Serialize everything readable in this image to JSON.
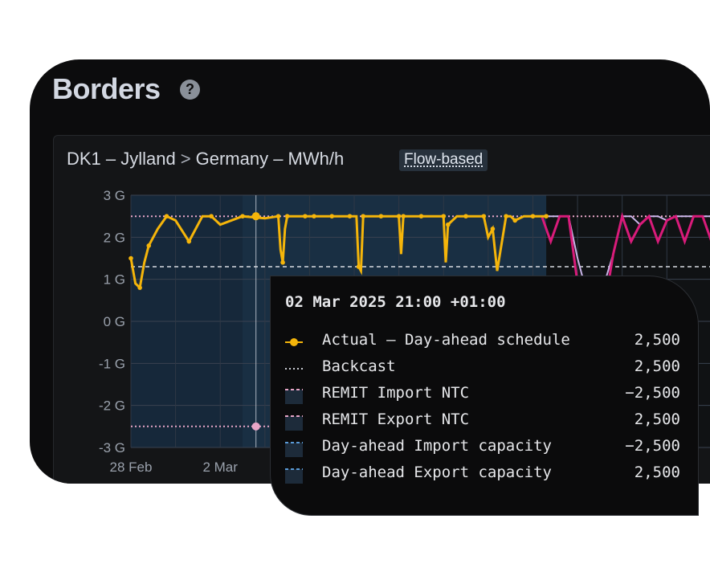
{
  "header": {
    "title": "Borders",
    "help_icon_text": "?"
  },
  "chart_header": {
    "from": "DK1 – Jylland",
    "separator": ">",
    "to": "Germany – MWh/h",
    "badge": "Flow-based"
  },
  "colors": {
    "actual": "#f5b50a",
    "backcast": "#c9b5e8",
    "remit": "#e8a6c8",
    "dayahead_capacity": "#5a9bd8",
    "magenta": "#d81b7a",
    "background": "#0c0c0d",
    "plot_fill": "#16283a"
  },
  "chart_data": {
    "type": "line",
    "ylim": [
      -3000,
      3000
    ],
    "yticks": [
      3000,
      2000,
      1000,
      0,
      -1000,
      -2000,
      -3000
    ],
    "ytick_labels": [
      "3 G",
      "2 G",
      "1 G",
      "0 G",
      "-1 G",
      "-2 G",
      "-3 G"
    ],
    "xtick_labels": [
      "28 Feb",
      "2 Mar"
    ],
    "grid": true,
    "series": [
      {
        "name": "Actual - Day-ahead schedule",
        "x": [
          0,
          0.1,
          0.2,
          0.3,
          0.4,
          0.6,
          0.8,
          1.0,
          1.3,
          1.6,
          1.8,
          2.0,
          2.5,
          3.0,
          3.3,
          3.35,
          3.4,
          3.45,
          3.5,
          3.7,
          3.9,
          4.0,
          4.1,
          4.3,
          4.5,
          4.7,
          4.9,
          5.05,
          5.1,
          5.15,
          5.2,
          5.4,
          5.6,
          5.8,
          6.0,
          6.05,
          6.1,
          6.3,
          6.5,
          6.8,
          7.0,
          7.05,
          7.1,
          7.3,
          7.5,
          7.7,
          7.9,
          8.0,
          8.1,
          8.2,
          8.4,
          8.5,
          8.6,
          8.8,
          9.0,
          9.2,
          9.3
        ],
        "values": [
          1500,
          900,
          800,
          1400,
          1800,
          2200,
          2500,
          2400,
          1900,
          2500,
          2500,
          2300,
          2500,
          2450,
          2500,
          1700,
          1400,
          2200,
          2500,
          2500,
          2500,
          2500,
          2500,
          2500,
          2500,
          2500,
          2500,
          2500,
          1300,
          1200,
          2500,
          2500,
          2500,
          2500,
          2500,
          1600,
          2500,
          2500,
          2500,
          2500,
          2500,
          1400,
          2300,
          2500,
          2500,
          2500,
          2500,
          2000,
          2200,
          1200,
          2500,
          2500,
          2400,
          2500,
          2500,
          2500,
          2500
        ]
      },
      {
        "name": "Backcast",
        "x": [
          9.2,
          9.4,
          9.6,
          9.8,
          10.0,
          10.2,
          10.4,
          10.6,
          10.8,
          11.0,
          11.2,
          11.4,
          11.6,
          11.8,
          12.0,
          12.2,
          12.4,
          12.6,
          12.8,
          13.0,
          13.2
        ],
        "values": [
          2500,
          2500,
          2500,
          2500,
          1500,
          700,
          400,
          900,
          1600,
          2500,
          2500,
          2300,
          2500,
          2500,
          2400,
          2500,
          2500,
          2500,
          2500,
          2500,
          2500
        ]
      },
      {
        "name": "REMIT Export NTC",
        "x": [
          0,
          13.2
        ],
        "values": [
          2500,
          2500
        ]
      },
      {
        "name": "REMIT Import NTC",
        "x": [
          0,
          4.8
        ],
        "values": [
          -2500,
          -2500
        ]
      },
      {
        "name": "Day-ahead Export capacity",
        "x": [
          0,
          13.2
        ],
        "values": [
          1300,
          1300
        ]
      }
    ]
  },
  "tooltip": {
    "timestamp": "02 Mar 2025 21:00 +01:00",
    "rows": [
      {
        "label": "Actual – Day-ahead schedule",
        "value": "2,500",
        "swatch": "dot-line",
        "color": "#f5b50a"
      },
      {
        "label": "Backcast",
        "value": "2,500",
        "swatch": "dotted",
        "color": "#c8cbd2"
      },
      {
        "label": "REMIT Import NTC",
        "value": "−2,500",
        "swatch": "box-pink",
        "color": "#e8a6c8"
      },
      {
        "label": "REMIT Export NTC",
        "value": "2,500",
        "swatch": "box-pink",
        "color": "#e8a6c8"
      },
      {
        "label": "Day-ahead Import capacity",
        "value": "−2,500",
        "swatch": "box-blue",
        "color": "#5a9bd8"
      },
      {
        "label": "Day-ahead Export capacity",
        "value": "2,500",
        "swatch": "box-blue",
        "color": "#5a9bd8"
      }
    ]
  }
}
